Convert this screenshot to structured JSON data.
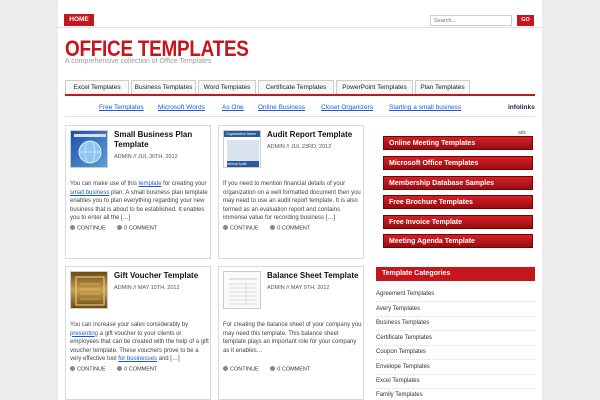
{
  "header": {
    "home_label": "HOME",
    "search_placeholder": "Search...",
    "go_label": "GO"
  },
  "site": {
    "title": "OFFICE TEMPLATES",
    "tagline": "A comprehensive collection of Office Templates"
  },
  "nav": {
    "items": [
      "Excel Templates",
      "Business Templates",
      "Word Templates",
      "Certificate Templates",
      "PowerPoint Templates",
      "Plan Templates"
    ]
  },
  "ad_links": {
    "items": [
      "Free Templates",
      "Microsoft Words",
      "As One",
      "Online Business",
      "Closet Organizers",
      "Starting a small business"
    ],
    "brand": "infolinks"
  },
  "posts": [
    {
      "title": "Small Business Plan Template",
      "meta": "ADMIN // JUL 30TH, 2012",
      "excerpt_lines": [
        "You can make use of this ",
        "template",
        " for creating your ",
        "small business",
        " plan. A small business plan template enables you to plan everything regarding your new business that is about to be established. It enables you to enter all the […]"
      ],
      "continue": "CONTINUE",
      "comment": "0 COMMENT"
    },
    {
      "title": "Audit Report Template",
      "meta": "ADMIN // JUL 23RD, 2012",
      "excerpt": "If you need to mention financial details of your organization on a well formatted document then you may need to use an audit report template. It is also termed as an evaluation report and contains immense value for recording business […]",
      "continue": "CONTINUE",
      "comment": "0 COMMENT"
    },
    {
      "title": "Gift Voucher Template",
      "meta": "ADMIN // MAY 15TH, 2012",
      "excerpt_a": "You can increase your sales considerably by ",
      "excerpt_link1": "presenting",
      "excerpt_b": " a gift voucher to your clients or employees that can be created with the help of a gift voucher template. These vouchers prove to be a very effective tool ",
      "excerpt_link2": "for businesses",
      "excerpt_c": " and […]",
      "continue": "CONTINUE",
      "comment": "0 COMMENT"
    },
    {
      "title": "Balance Sheet Template",
      "meta": "ADMIN // MAY 9TH, 2012",
      "excerpt": "For creating the balance sheet of your company you may need this template. This balance sheet template plays an important role for your company as it enables…",
      "continue": "CONTINUE",
      "comment": "0 COMMENT"
    }
  ],
  "sidebar": {
    "ads_label": "ads",
    "ad_buttons": [
      "Online Meeting Templates",
      "Microsoft Office Templates",
      "Membership Database Samples",
      "Free Brochure Templates",
      "Free Invoice Template",
      "Meeting Agenda Template"
    ],
    "categories_title": "Template Categories",
    "categories": [
      "Agreement Templates",
      "Avery Templates",
      "Business Templates",
      "Certificate Templates",
      "Coupon Templates",
      "Envelope Templates",
      "Excel Templates",
      "Family Templates"
    ]
  },
  "thumb_labels": {
    "audit_header": "Organization Name",
    "audit_sub": "Internal Audit"
  },
  "colors": {
    "accent": "#c4161c",
    "link": "#1a5ad8"
  }
}
